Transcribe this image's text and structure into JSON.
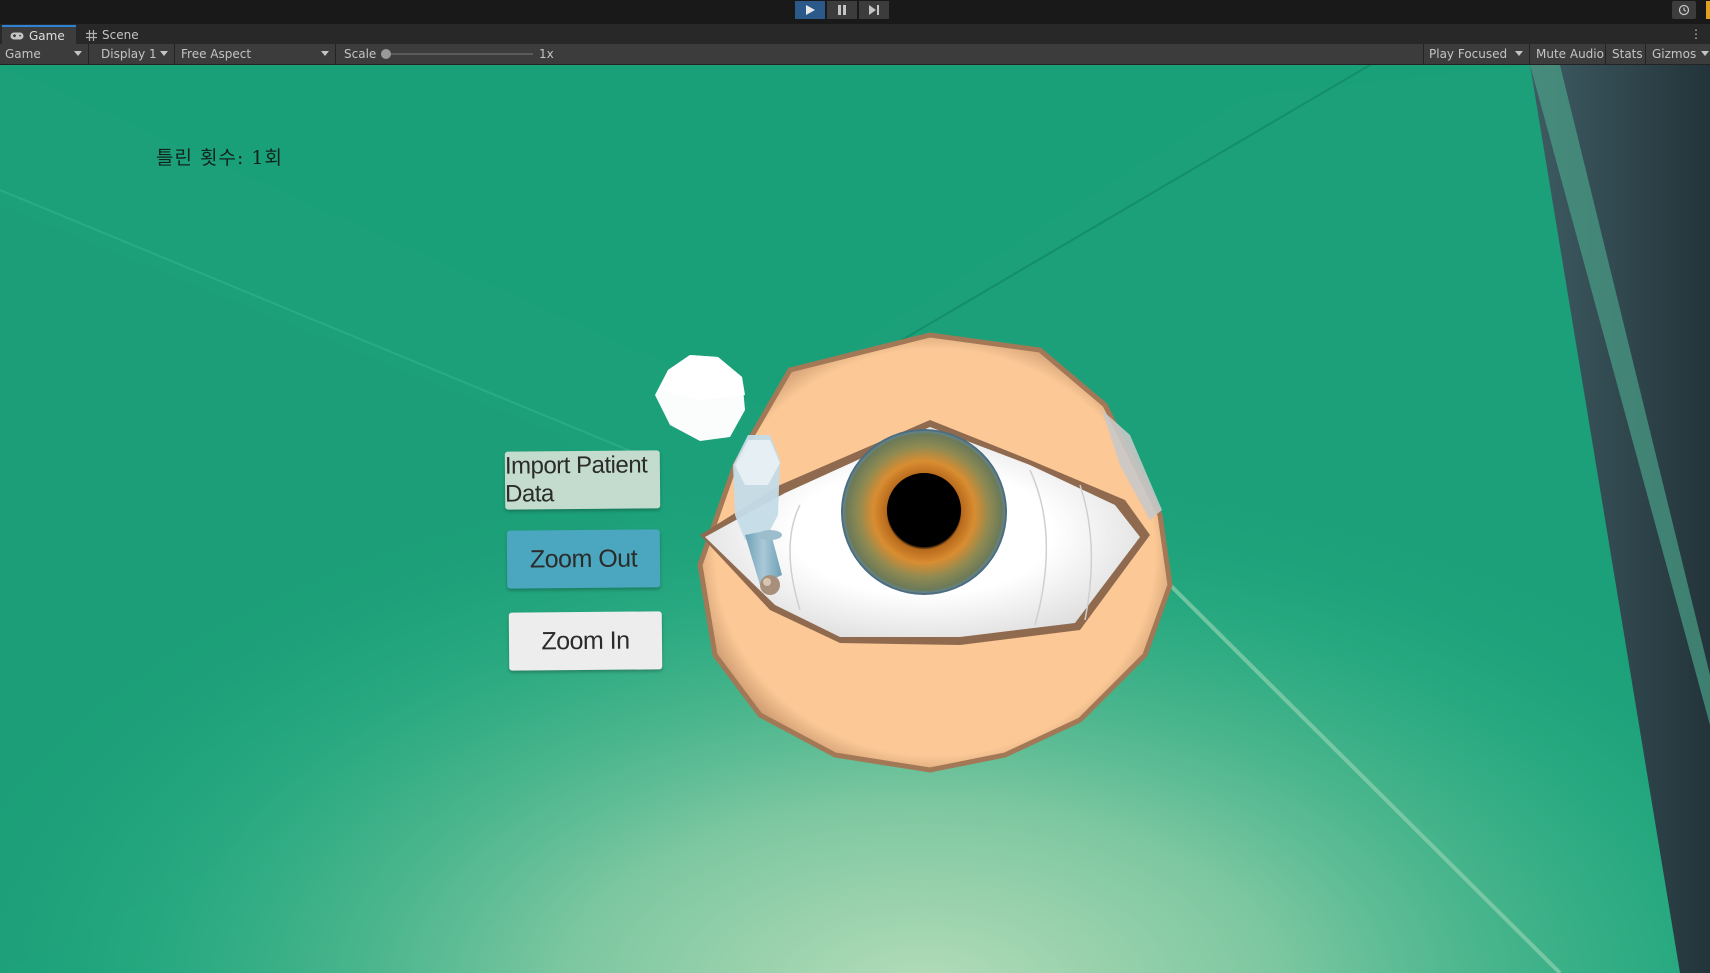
{
  "play_controls": {
    "play": "play-icon",
    "pause": "pause-icon",
    "step": "step-icon"
  },
  "tabs": [
    {
      "label": "Game",
      "icon": "gamepad-icon"
    },
    {
      "label": "Scene",
      "icon": "grid-icon"
    }
  ],
  "toolbar": {
    "view_mode": "Game",
    "display": "Display 1",
    "aspect": "Free Aspect",
    "scale_label": "Scale",
    "scale_value": "1x",
    "play_mode": "Play Focused",
    "mute_audio": "Mute Audio",
    "stats": "Stats",
    "gizmos": "Gizmos"
  },
  "game": {
    "wrong_count": "틀린 횟수: 1회",
    "buttons": {
      "import": "Import Patient Data",
      "zoom_out": "Zoom Out",
      "zoom_in": "Zoom In"
    }
  },
  "colors": {
    "background": "#1aa078",
    "zoom_out_button": "#4aa7bf",
    "import_button": "#c3dccd",
    "zoom_in_button": "#ededed",
    "skin": "#f9c595"
  }
}
